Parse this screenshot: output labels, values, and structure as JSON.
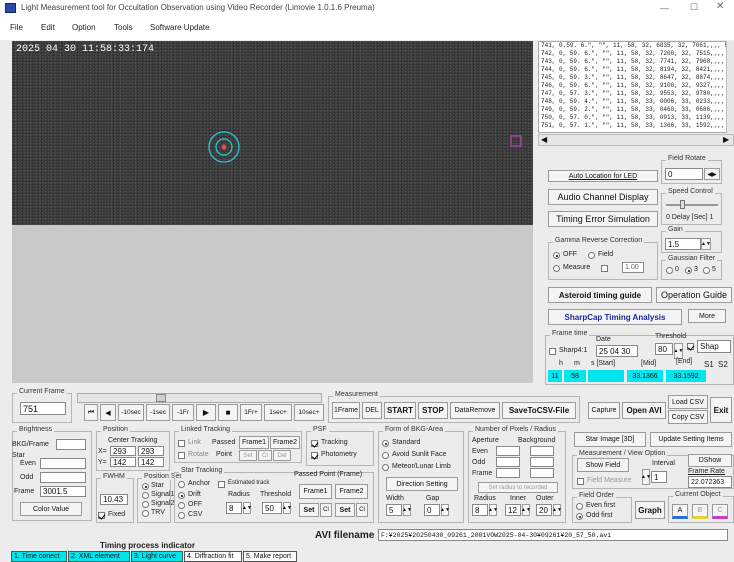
{
  "window": {
    "title": "Light Measurement tool for Occultation Observation using Video Recorder (Limovie 1.0.1.6 Preuma)"
  },
  "menu": [
    "File",
    "Edit",
    "Option",
    "Tools",
    "Software Update"
  ],
  "video": {
    "timestamp": "2025 04 30  11:58:33:174"
  },
  "log": [
    "741, 0.59. 6.\", \"\", 11, 58, 32, 6835, 32, 7061,,,, 50",
    "742, 0, 59. 6.\", \"\", 11, 58, 32, 7200, 32, 7515,,,, 29",
    "743, 0, 59. 6.\", \"\", 11, 58, 32, 7741, 32, 7968,,,, 25",
    "744, 0, 59. 6.\", \"\", 11, 58, 32, 8194, 32, 8421,,,, 52",
    "745, 0, 59. 3.\", \"\", 11, 58, 32, 8647, 32, 8874,,,, 46",
    "746, 0, 59. 6.\", \"\", 11, 58, 32, 9100, 32, 9327,,,, 41",
    "747, 0, 57. 3.\", \"\", 11, 58, 32, 9553, 32, 9780,,,, 12",
    "748, 0, 59. 4.\", \"\", 11, 58, 33, 0006, 33, 0233,,,, 46",
    "749, 0, 59. 2.\", \"\", 11, 58, 33, 0460, 33, 0686,,,, 57",
    "750, 0, 57. 0.\", \"\", 11, 58, 33, 0913, 33, 1139,,,, 34",
    "751, 0, 57. 1.\", \"\", 11, 58, 33, 1366, 33, 1592,,,, 30"
  ],
  "right": {
    "auto_location": "Auto Location for LED",
    "audio_channel": "Audio Channel Display",
    "timing_error": "Timing Error Simulation",
    "field_rotate": "Field Rotate",
    "field_rotate_val": "0",
    "speed_control": "Speed Control",
    "delay": "0  Delay [Sec] 1",
    "gamma": "Gamma Reverse Correction",
    "gamma_off": "OFF",
    "gamma_field": "Field",
    "gamma_measure": "Measure",
    "gamma_val": "1.00",
    "gain": "Gain",
    "gain_val": "1.5",
    "gaussian": "Gaussian Filter",
    "g0": "0",
    "g3": "3",
    "g5": "5",
    "asteroid_guide": "Asteroid timing guide",
    "operation_guide": "Operation Guide",
    "sharpcap": "SharpCap Timing Analysis",
    "more": "More",
    "frame_time": "Frame time",
    "date_lbl": "Date",
    "threshold_lbl": "Threshold",
    "sharp41": "Sharp4:1",
    "date_val": "25 04 30",
    "thr_val": "80",
    "shap": "Shap",
    "h": "h",
    "m": "m",
    "s_start": "s [Start]",
    "mid": "[Mid]",
    "end": "[End]",
    "s1": "S1",
    "s2": "S2",
    "hv": "11",
    "mv": "58",
    "midv": "33.1366",
    "endv": "33.1592"
  },
  "control": {
    "current_frame_lbl": "Current Frame",
    "current_frame": "751",
    "measurement_lbl": "Measurement",
    "b_first": "⏮",
    "b_back": "◀",
    "b_m10": "-10sec",
    "b_m1": "-1sec",
    "b_m1f": "-1Fr",
    "b_play": "▶",
    "b_stop": "■",
    "b_p1f": "1Fr+",
    "b_p1": "1sec+",
    "b_p10": "10sec+",
    "b_1frame": "1Frame",
    "b_del": "DEL",
    "b_start": "START",
    "b_stop2": "STOP",
    "b_dataremove": "DataRemove",
    "b_save": "SaveToCSV-File",
    "b_capture": "Capture",
    "b_openavi": "Open AVI",
    "b_loadcsv": "Load CSV",
    "b_copycsv": "Copy CSV",
    "b_exit": "Exit"
  },
  "lower": {
    "brightness": "Brightness",
    "bkg_frame": "BKG/Frame",
    "star": "Star",
    "even": "Even",
    "odd": "Odd",
    "frame": "Frame",
    "frame_val": "3001.5",
    "color_value": "Color Value",
    "position": "Position",
    "center_tracking": "Center Tracking",
    "x": "X=",
    "y": "Y=",
    "x1": "293",
    "x2": "293",
    "y1": "142",
    "y2": "142",
    "fwhm": "FWHM",
    "fwhm_val": "10.43",
    "fixed": "Fixed",
    "position_set": "Position Set",
    "ps_star": "Star",
    "ps_sig1": "Signal1",
    "ps_sig2": "Signal2",
    "ps_tr": "TRV",
    "linked": "Linked Tracking",
    "link": "Link",
    "passed": "Passed",
    "frame1": "Frame1",
    "frame2": "Frame2",
    "rotate": "Rotate",
    "point": "Point",
    "set": "Set",
    "cl": "Cl",
    "del": "Del",
    "star_tracking": "Star Tracking",
    "anchor": "Anchor",
    "estimated_track": "Estimated track",
    "drift": "Drift",
    "radius": "Radius",
    "threshold": "Threshold",
    "off": "OFF",
    "csv": "CSV",
    "r_val": "8",
    "t_val": "50",
    "passed_point": "Passed Point (Frame)",
    "pf1": "Frame1",
    "pf2": "Frame2",
    "psf": "PSF",
    "tracking": "Tracking",
    "photometry": "Photometry",
    "form_bkg": "Form of BKG-Area",
    "standard": "Standard",
    "avoid": "Avoid Sunlit Face",
    "meteor": "Meteor/Lunar Limb",
    "direction": "Direction Setting",
    "width": "Width",
    "gap": "Gap",
    "w_val": "5",
    "g_val": "0",
    "num_pixels": "Number of Pixels / Radius",
    "aperture": "Aperture",
    "background": "Background",
    "n_even": "Even",
    "n_odd": "Odd",
    "n_frame": "Frame",
    "set_radius": "Set radius to recorded",
    "radius_lbl": "Radius",
    "inner": "Inner",
    "outer": "Outer",
    "r1": "8",
    "r2": "12",
    "r3": "20",
    "star_image": "Star Image [3D]",
    "update_setting": "Update Setting Items",
    "meas_view": "Measurement / View Option",
    "show_field": "Show Field",
    "interval": "Interval",
    "field_measure": "Field Measure",
    "interval_val": "1",
    "dshow": "DShow",
    "frame_rate": "Frame Rate",
    "frame_rate_val": "22.072363",
    "field_order": "Field Order",
    "even_first": "Even first",
    "odd_first": "Odd first",
    "graph": "Graph",
    "current_object": "Current Object",
    "obj_a": "A",
    "obj_b": "B",
    "obj_c": "C"
  },
  "footer": {
    "avi_label": "AVI filename :",
    "avi_path": "F:¥2025¥20250430_09261_2001VOW2025-04-30¥09261¥20_57_50.avi",
    "timing_indicator": "Timing process indicator",
    "steps": [
      "1. Time conect",
      "2. XML element",
      "3. Light curve",
      "4. Diffraction fit",
      "5. Make report"
    ]
  },
  "colors": {
    "cyan": "#00e5ee",
    "target_ring": "#2ec4d6",
    "magenta": "#c040c0"
  }
}
